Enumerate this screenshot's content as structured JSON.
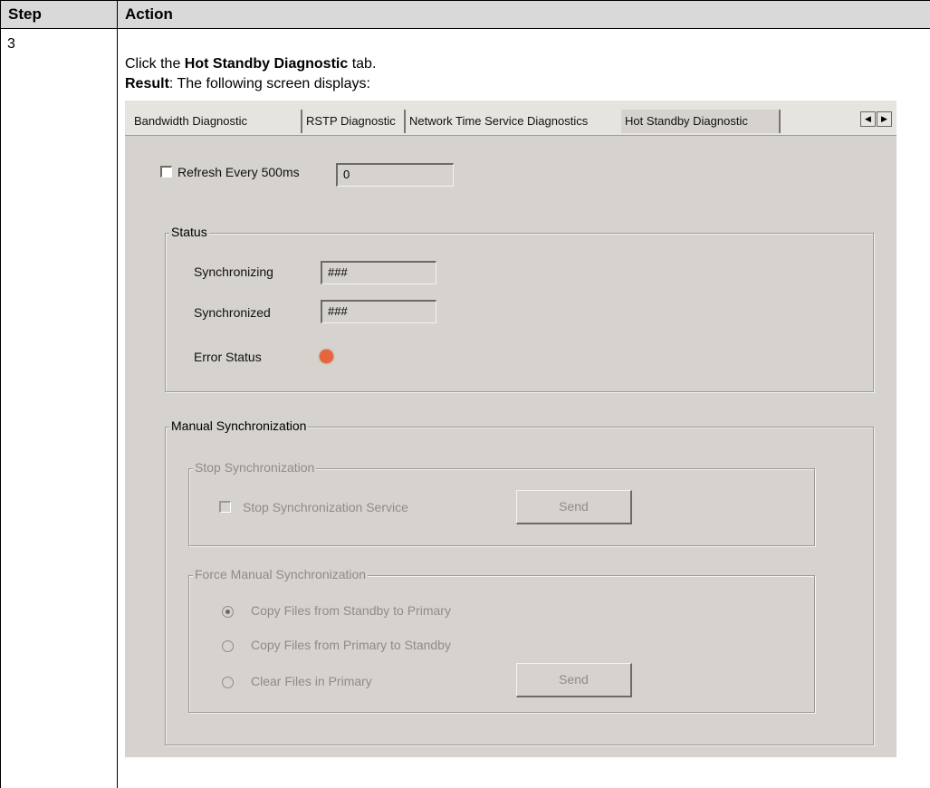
{
  "table": {
    "header_step": "Step",
    "header_action": "Action",
    "step_number": "3",
    "instruction_pre": "Click the ",
    "instruction_bold": "Hot Standby Diagnostic",
    "instruction_post": " tab.",
    "result_label": "Result",
    "result_text": ": The following screen displays:"
  },
  "screenshot": {
    "tabs": [
      "Bandwidth Diagnostic",
      "RSTP Diagnostic",
      "Network Time Service Diagnostics",
      "Hot Standby Diagnostic"
    ],
    "active_tab": "Hot Standby Diagnostic",
    "refresh_label": "Refresh Every 500ms",
    "refresh_checked": false,
    "refresh_value": "0",
    "status": {
      "title": "Status",
      "synchronizing_label": "Synchronizing",
      "synchronizing_value": "###",
      "synchronized_label": "Synchronized",
      "synchronized_value": "###",
      "error_status_label": "Error Status",
      "error_led_color": "#e8643c"
    },
    "manual_sync": {
      "title": "Manual Synchronization",
      "stop": {
        "title": "Stop Synchronization",
        "checkbox_label": "Stop Synchronization Service",
        "send_label": "Send"
      },
      "force": {
        "title": "Force Manual Synchronization",
        "options": [
          "Copy Files from Standby to Primary",
          "Copy Files from Primary to Standby",
          "Clear Files in Primary"
        ],
        "selected_index": 0,
        "send_label": "Send"
      }
    }
  },
  "colors": {
    "header_bg": "#d9d9d9",
    "panel_bg": "#d6d3ce",
    "disabled_text": "#8f8c87"
  }
}
